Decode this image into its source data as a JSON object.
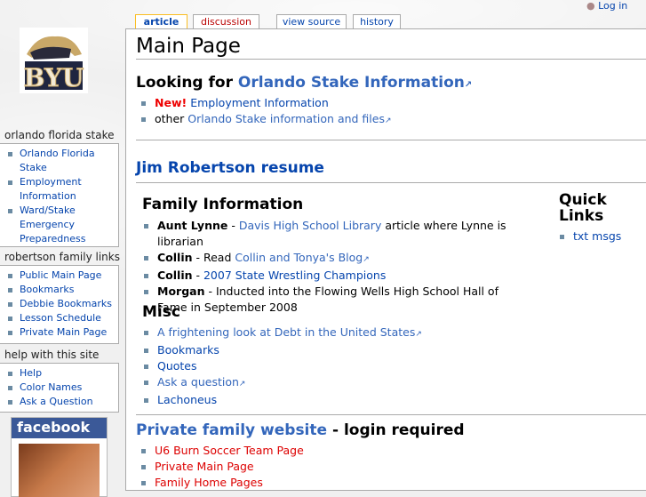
{
  "user": {
    "login": "Log in"
  },
  "tabs": [
    {
      "label": "article"
    },
    {
      "label": "discussion"
    },
    {
      "label": "view source"
    },
    {
      "label": "history"
    }
  ],
  "logo_text": "BYU",
  "sidebar": [
    {
      "title": "orlando florida stake",
      "items": [
        "Orlando Florida Stake",
        "Employment Information",
        "Ward/Stake Emergency Preparedness"
      ]
    },
    {
      "title": "robertson family links",
      "items": [
        "Public Main Page",
        "Bookmarks",
        "Debbie Bookmarks",
        "Lesson Schedule",
        "Private Main Page"
      ]
    },
    {
      "title": "help with this site",
      "items": [
        "Help",
        "Color Names",
        "Ask a Question"
      ]
    }
  ],
  "facebook": {
    "label": "facebook"
  },
  "page": {
    "title": "Main Page",
    "looking": {
      "prefix": "Looking for ",
      "link": "Orlando Stake Information",
      "items": [
        {
          "badge": "New!",
          "link": "Employment Information"
        },
        {
          "text": "other ",
          "link": "Orlando Stake information and files"
        }
      ]
    },
    "resume": "Jim Robertson resume",
    "family_heading": "Family Information",
    "family": [
      {
        "name": "Aunt Lynne",
        "sep": " - ",
        "link": "Davis High School Library",
        "rest": " article where Lynne is librarian"
      },
      {
        "name": "Collin",
        "sep": " - Read ",
        "link": "Collin and Tonya's Blog",
        "rest": ""
      },
      {
        "name": "Collin",
        "sep": " - ",
        "link": "2007 State Wrestling Champions",
        "rest": ""
      },
      {
        "name": "Morgan",
        "sep": " - Inducted into the Flowing Wells High School Hall of Fame in September 2008",
        "link": "",
        "rest": ""
      }
    ],
    "quick_links": {
      "title": "Quick Links",
      "items": [
        "txt msgs"
      ]
    },
    "misc_heading": "Misc",
    "misc": [
      "A frightening look at Debt in the United States",
      "Bookmarks",
      "Quotes",
      "Ask a question",
      "Lachoneus"
    ],
    "private": {
      "link": "Private family website",
      "rest": " - login required",
      "items": [
        "U6 Burn Soccer Team Page",
        "Private Main Page",
        "Family Home Pages"
      ]
    }
  }
}
